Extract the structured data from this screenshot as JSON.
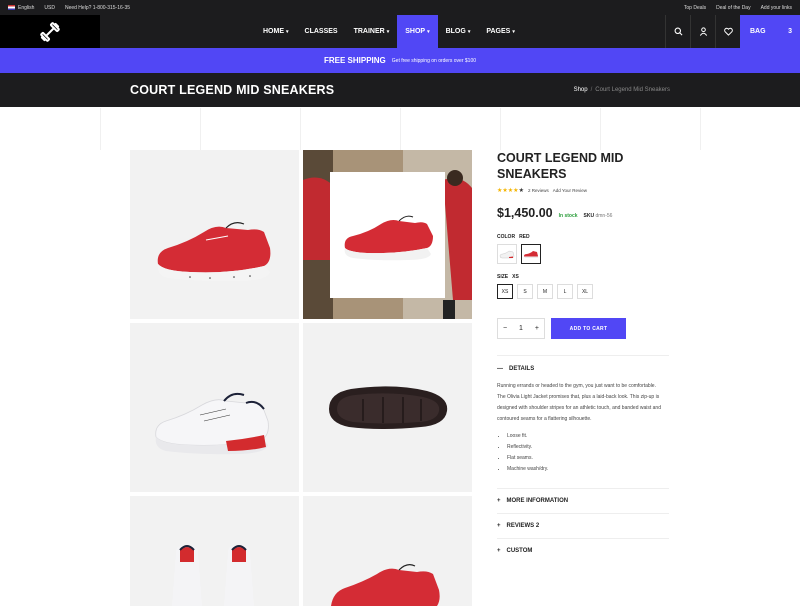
{
  "topbar": {
    "language": "English",
    "currency": "USD",
    "help": "Need Help? 1-800-315-16-35",
    "links": [
      "Top Deals",
      "Deal of the Day",
      "Add your links"
    ]
  },
  "nav": {
    "menu": [
      {
        "label": "HOME",
        "caret": true,
        "active": false
      },
      {
        "label": "CLASSES",
        "caret": false,
        "active": false
      },
      {
        "label": "TRAINER",
        "caret": true,
        "active": false
      },
      {
        "label": "SHOP",
        "caret": true,
        "active": true
      },
      {
        "label": "BLOG",
        "caret": true,
        "active": false
      },
      {
        "label": "PAGES",
        "caret": true,
        "active": false
      }
    ],
    "bag_label": "BAG",
    "bag_count": "3"
  },
  "shipping": {
    "title": "FREE SHIPPING",
    "text": "Get free shipping on orders over $100"
  },
  "page": {
    "title": "COURT LEGEND MID SNEAKERS",
    "breadcrumb": {
      "parent": "Shop",
      "separator": "/",
      "current": "Court Legend Mid Sneakers"
    }
  },
  "product": {
    "name": "COURT LEGEND MID SNEAKERS",
    "rating": 4,
    "reviews": "2 Reviews",
    "add_review": "Add Your Review",
    "price": "$1,450.00",
    "stock": "In stock",
    "sku_label": "SKU",
    "sku": "dmn-56",
    "color_label": "COLOR",
    "color_value": "RED",
    "size_label": "SIZE",
    "size_value": "XS",
    "sizes": [
      "XS",
      "S",
      "M",
      "L",
      "XL"
    ],
    "quantity": "1",
    "qty_minus": "−",
    "qty_plus": "+",
    "add_to_cart": "ADD TO CART"
  },
  "details": {
    "title": "DETAILS",
    "text": "Running errands or headed to the gym, you just want to be comfortable. The Olivia Light Jacket promises that, plus a laid-back look. This zip-up is designed with shoulder stripes for an athletic touch, and banded waist and contoured seams for a flattering silhouette.",
    "bullets": [
      "Loose fit.",
      "Reflectivity.",
      "Flat seams.",
      "Machine wash/dry."
    ]
  },
  "sections": [
    "MORE INFORMATION",
    "REVIEWS 2",
    "CUSTOM"
  ],
  "colors": {
    "accent": "#5147f5",
    "dark": "#1c1c1e",
    "stock": "#2a9d3a",
    "star": "#f4b400"
  }
}
